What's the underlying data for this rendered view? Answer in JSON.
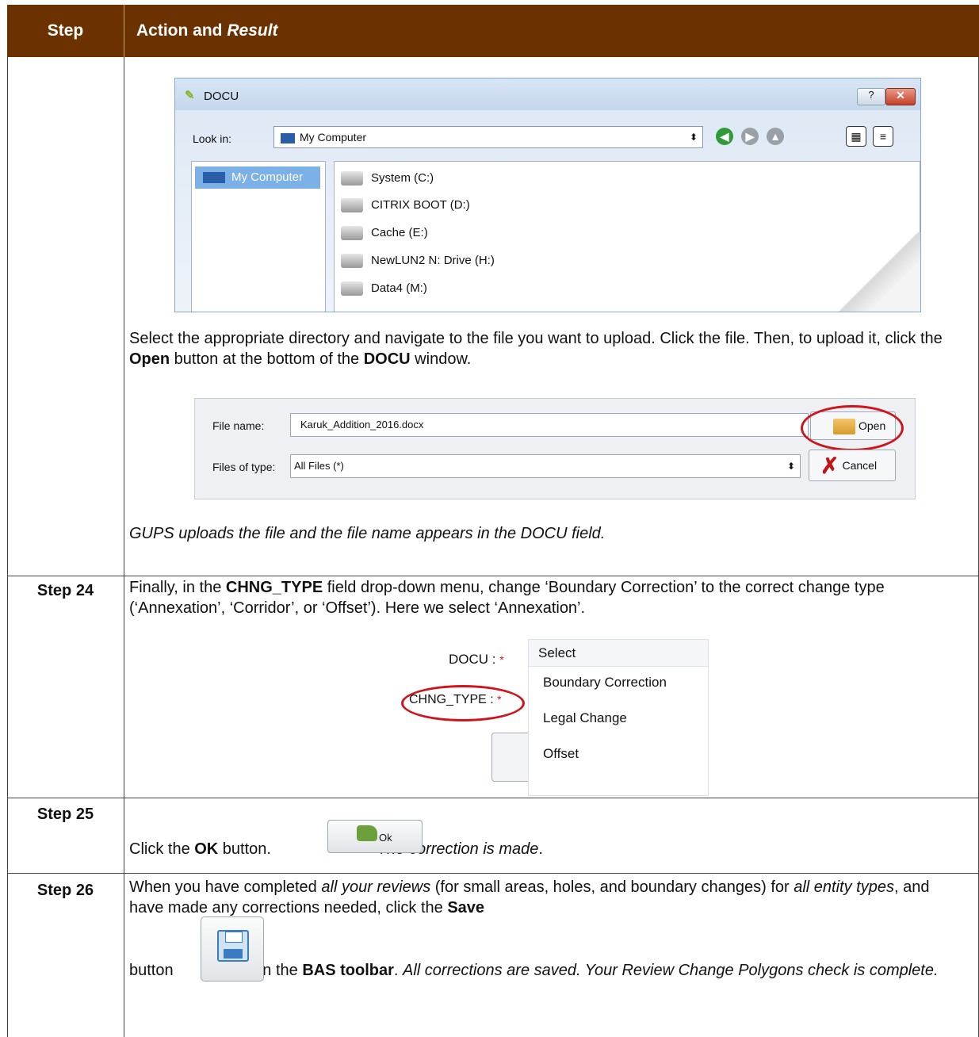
{
  "header": {
    "col1": "Step",
    "col2_plain": "Action and ",
    "col2_italic": "Result"
  },
  "dialog": {
    "title": "DOCU",
    "help": "?",
    "close": "✕",
    "look_in_label": "Look in:",
    "look_in_value": "My Computer",
    "sidebar_item": "My Computer",
    "drives": [
      "System (C:)",
      "CITRIX BOOT (D:)",
      "Cache (E:)",
      "NewLUN2 N: Drive (H:)",
      "Data4 (M:)"
    ]
  },
  "row23": {
    "p1_a": "Select the appropriate directory and navigate to the file you want to upload. Click the file. Then, to upload it, click the ",
    "p1_b": "Open",
    "p1_c": " button at the bottom of the ",
    "p1_d": "DOCU",
    "p1_e": " window.",
    "result": "GUPS uploads the file and the file name appears in the DOCU field."
  },
  "filepanel": {
    "file_name_label": "File name:",
    "file_name_value": "Karuk_Addition_2016.docx",
    "files_of_type_label": "Files of type:",
    "files_of_type_value": "All Files (*)",
    "open": "Open",
    "cancel": "Cancel"
  },
  "row24": {
    "step": "Step 24",
    "t1": "Finally, in the ",
    "t2": "CHNG_TYPE",
    "t3": " field drop-down menu, change ‘Boundary Correction’ to the correct change type (‘Annexation’, ‘Corridor’, or ‘Offset’). Here we select ‘Annexation’.",
    "docu_label": "DOCU :",
    "chng_label": "CHNG_TYPE :",
    "asterisk": "*",
    "menu": [
      "Select",
      "Boundary Correction",
      "Legal Change",
      "Offset"
    ]
  },
  "row25": {
    "step": "Step 25",
    "t1": "Click the ",
    "t2": "OK",
    "t3": " button.",
    "ok_label": "Ok",
    "result": "The correction is made",
    "end": "."
  },
  "row26": {
    "step": "Step 26",
    "a": "When you have completed ",
    "b": "all your reviews",
    "c": " (for small areas, holes, and boundary changes) for ",
    "d": "all entity types",
    "e": ", and have made any corrections needed, click the ",
    "f": "Save",
    "g": "button",
    "h": " on the ",
    "i": "BAS toolbar",
    "j": ". ",
    "k": "All corrections are saved. Your Review Change Polygons check is complete."
  }
}
